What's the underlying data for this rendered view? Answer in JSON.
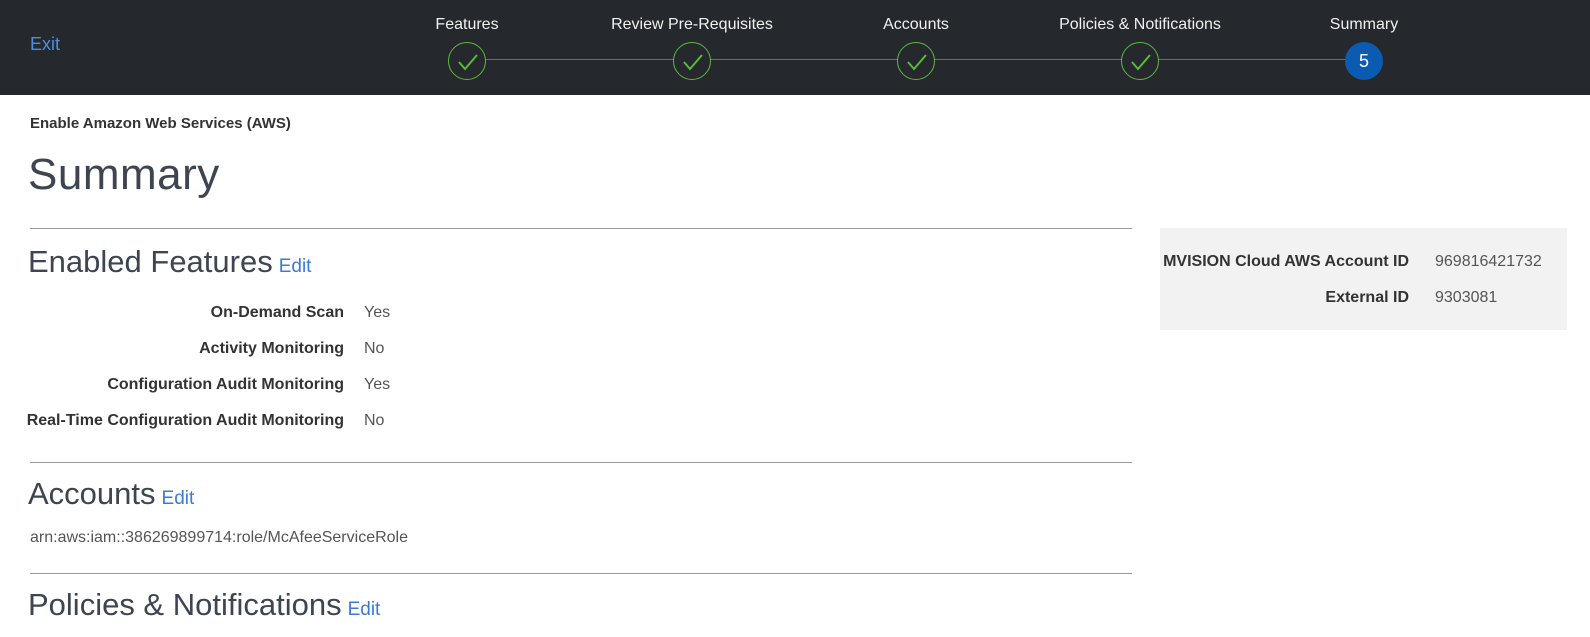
{
  "header": {
    "exit_label": "Exit",
    "steps": [
      {
        "label": "Features",
        "status": "complete"
      },
      {
        "label": "Review Pre-Requisites",
        "status": "complete"
      },
      {
        "label": "Accounts",
        "status": "complete"
      },
      {
        "label": "Policies & Notifications",
        "status": "complete"
      },
      {
        "label": "Summary",
        "status": "active",
        "number": "5"
      }
    ],
    "colors": {
      "bar_bg": "#25282c",
      "check_green": "#5cb83c",
      "active_blue": "#0b5cb0",
      "link_blue": "#4a90e2"
    }
  },
  "page": {
    "subtitle": "Enable Amazon Web Services (AWS)",
    "title": "Summary"
  },
  "enabled_features": {
    "title": "Enabled Features",
    "edit_label": "Edit",
    "rows": [
      {
        "label": "On-Demand Scan",
        "value": "Yes"
      },
      {
        "label": "Activity Monitoring",
        "value": "No"
      },
      {
        "label": "Configuration Audit Monitoring",
        "value": "Yes"
      },
      {
        "label": "Real-Time Configuration Audit Monitoring",
        "value": "No"
      }
    ]
  },
  "accounts": {
    "title": "Accounts",
    "edit_label": "Edit",
    "arn": "arn:aws:iam::386269899714:role/McAfeeServiceRole"
  },
  "policies": {
    "title": "Policies & Notifications",
    "edit_label": "Edit"
  },
  "info_panel": {
    "rows": [
      {
        "label": "MVISION Cloud AWS Account ID",
        "value": "969816421732"
      },
      {
        "label": "External ID",
        "value": "9303081"
      }
    ]
  }
}
